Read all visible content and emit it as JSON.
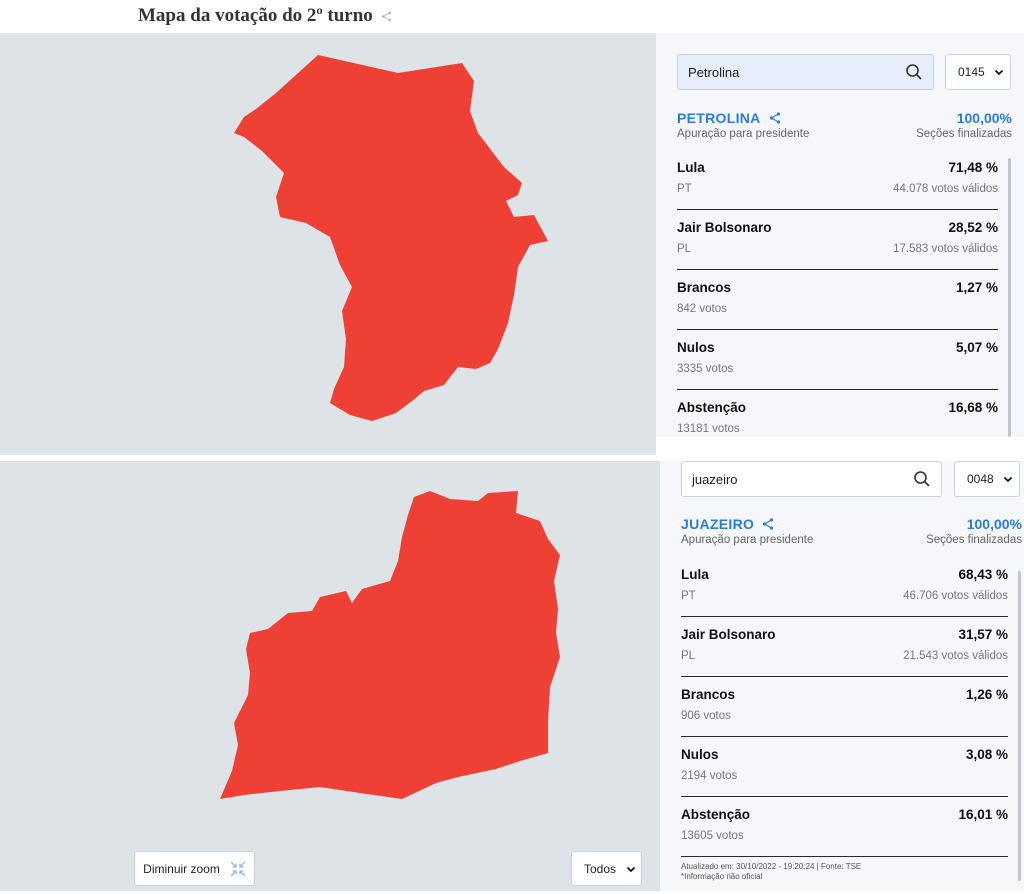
{
  "page_title": "Mapa da votação do 2º turno",
  "colors": {
    "accent": "#2a7ae2",
    "map_fill": "#ee4035",
    "map_bg": "#dee3e8",
    "panel_bg": "#f5f7fa"
  },
  "top": {
    "search": {
      "value": "Petrolina",
      "icon": "search-icon"
    },
    "zone_select": {
      "value": "0145"
    },
    "city": {
      "name": "PETROLINA",
      "subtitle": "Apuração para presidente",
      "percent": "100,00%",
      "percent_label": "Seções finalizadas"
    },
    "results": [
      {
        "name": "Lula",
        "percent": "71,48 %",
        "party": "PT",
        "votes": "44.078 votos válidos"
      },
      {
        "name": "Jair Bolsonaro",
        "percent": "28,52 %",
        "party": "PL",
        "votes": "17.583 votos válidos"
      },
      {
        "name": "Brancos",
        "percent": "1,27 %",
        "party": "842 votos",
        "votes": ""
      },
      {
        "name": "Nulos",
        "percent": "5,07 %",
        "party": "3335 votos",
        "votes": ""
      },
      {
        "name": "Abstenção",
        "percent": "16,68 %",
        "party": "13181 votos",
        "votes": ""
      }
    ]
  },
  "bottom": {
    "search": {
      "value": "juazeiro",
      "icon": "search-icon"
    },
    "zone_select": {
      "value": "0048"
    },
    "city": {
      "name": "JUAZEIRO",
      "subtitle": "Apuração para presidente",
      "percent": "100,00%",
      "percent_label": "Seções finalizadas"
    },
    "results": [
      {
        "name": "Lula",
        "percent": "68,43 %",
        "party": "PT",
        "votes": "46.706 votos válidos"
      },
      {
        "name": "Jair Bolsonaro",
        "percent": "31,57 %",
        "party": "PL",
        "votes": "21.543 votos válidos"
      },
      {
        "name": "Brancos",
        "percent": "1,26 %",
        "party": "906 votos",
        "votes": ""
      },
      {
        "name": "Nulos",
        "percent": "3,08 %",
        "party": "2194 votos",
        "votes": ""
      },
      {
        "name": "Abstenção",
        "percent": "16,01 %",
        "party": "13605 votos",
        "votes": ""
      }
    ],
    "zoom_button": {
      "label": "Diminuir zoom",
      "icon": "collapse-icon"
    },
    "filter_select": {
      "value": "Todos"
    },
    "footnote": {
      "line1": "Atualizado em: 30/10/2022 - 19:20:24 | Fonte: TSE",
      "line2": "*Informação não oficial"
    }
  }
}
